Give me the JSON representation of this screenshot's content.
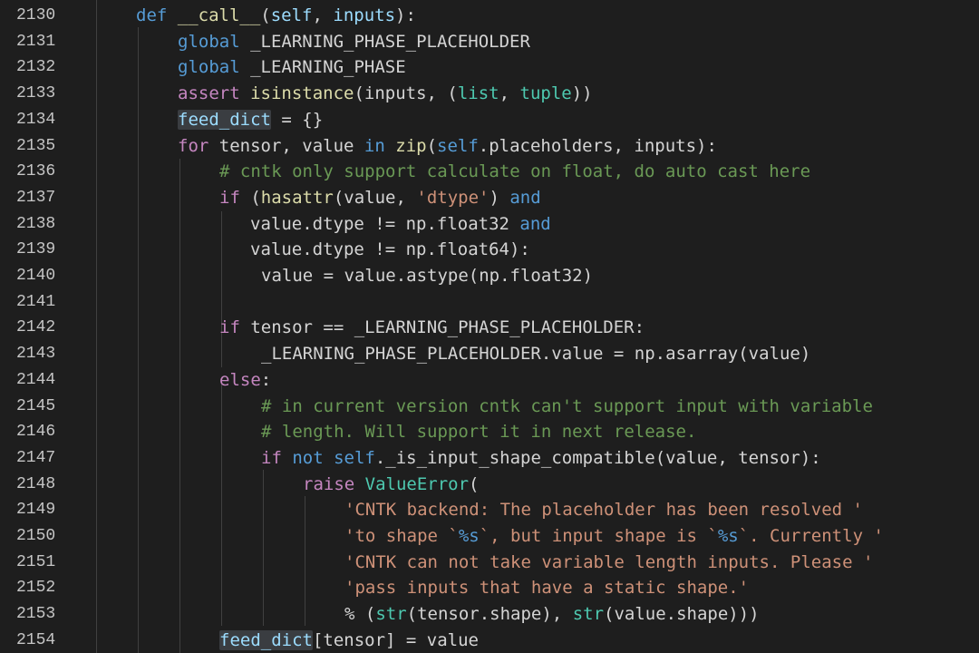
{
  "editor": {
    "language": "python",
    "colors": {
      "background": "#1e1e1e",
      "keyword": "#569cd6",
      "control": "#c586c0",
      "function": "#dcdcaa",
      "variable": "#9cdcfe",
      "string": "#ce9178",
      "class": "#4ec9b0",
      "comment": "#6a9955",
      "line_number": "#c5c5c5"
    },
    "lines": [
      {
        "n": "2130",
        "tokens": [
          [
            "kw",
            "def "
          ],
          [
            "fn",
            "__call__"
          ],
          [
            "plain",
            "("
          ],
          [
            "var",
            "self"
          ],
          [
            "plain",
            ", "
          ],
          [
            "var",
            "inputs"
          ],
          [
            "plain",
            "):"
          ]
        ]
      },
      {
        "n": "2131",
        "tokens": [
          [
            "kw",
            "global "
          ],
          [
            "plain",
            "_LEARNING_PHASE_PLACEHOLDER"
          ]
        ]
      },
      {
        "n": "2132",
        "tokens": [
          [
            "kw",
            "global "
          ],
          [
            "plain",
            "_LEARNING_PHASE"
          ]
        ]
      },
      {
        "n": "2133",
        "tokens": [
          [
            "ctl",
            "assert "
          ],
          [
            "fn",
            "isinstance"
          ],
          [
            "plain",
            "(inputs, ("
          ],
          [
            "cls",
            "list"
          ],
          [
            "plain",
            ", "
          ],
          [
            "cls",
            "tuple"
          ],
          [
            "plain",
            "))"
          ]
        ]
      },
      {
        "n": "2134",
        "tokens": [
          [
            "hl",
            "feed_dict"
          ],
          [
            "plain",
            " = {}"
          ]
        ]
      },
      {
        "n": "2135",
        "tokens": [
          [
            "ctl",
            "for "
          ],
          [
            "plain",
            "tensor, value "
          ],
          [
            "kw",
            "in "
          ],
          [
            "fn",
            "zip"
          ],
          [
            "plain",
            "("
          ],
          [
            "self",
            "self"
          ],
          [
            "plain",
            ".placeholders, inputs):"
          ]
        ]
      },
      {
        "n": "2136",
        "tokens": [
          [
            "com",
            "# cntk only support calculate on float, do auto cast here"
          ]
        ]
      },
      {
        "n": "2137",
        "tokens": [
          [
            "ctl",
            "if "
          ],
          [
            "plain",
            "("
          ],
          [
            "fn",
            "hasattr"
          ],
          [
            "plain",
            "(value, "
          ],
          [
            "str",
            "'dtype'"
          ],
          [
            "plain",
            ") "
          ],
          [
            "kw",
            "and"
          ]
        ]
      },
      {
        "n": "2138",
        "tokens": [
          [
            "plain",
            "value.dtype != np.float32 "
          ],
          [
            "kw",
            "and"
          ]
        ]
      },
      {
        "n": "2139",
        "tokens": [
          [
            "plain",
            "value.dtype != np.float64):"
          ]
        ]
      },
      {
        "n": "2140",
        "tokens": [
          [
            "plain",
            "value = value.astype(np.float32)"
          ]
        ]
      },
      {
        "n": "2141",
        "tokens": []
      },
      {
        "n": "2142",
        "tokens": [
          [
            "ctl",
            "if "
          ],
          [
            "plain",
            "tensor == _LEARNING_PHASE_PLACEHOLDER:"
          ]
        ]
      },
      {
        "n": "2143",
        "tokens": [
          [
            "plain",
            "_LEARNING_PHASE_PLACEHOLDER.value = np.asarray(value)"
          ]
        ]
      },
      {
        "n": "2144",
        "tokens": [
          [
            "ctl",
            "else"
          ],
          [
            "plain",
            ":"
          ]
        ]
      },
      {
        "n": "2145",
        "tokens": [
          [
            "com",
            "# in current version cntk can't support input with variable"
          ]
        ]
      },
      {
        "n": "2146",
        "tokens": [
          [
            "com",
            "# length. Will support it in next release."
          ]
        ]
      },
      {
        "n": "2147",
        "tokens": [
          [
            "ctl",
            "if "
          ],
          [
            "kw",
            "not "
          ],
          [
            "self",
            "self"
          ],
          [
            "plain",
            "._is_input_shape_compatible(value, tensor):"
          ]
        ]
      },
      {
        "n": "2148",
        "tokens": [
          [
            "ctl",
            "raise "
          ],
          [
            "cls",
            "ValueError"
          ],
          [
            "plain",
            "("
          ]
        ]
      },
      {
        "n": "2149",
        "tokens": [
          [
            "str",
            "'CNTK backend: The placeholder has been resolved '"
          ]
        ]
      },
      {
        "n": "2150",
        "tokens": [
          [
            "str",
            "'to shape `"
          ],
          [
            "esc",
            "%s"
          ],
          [
            "str",
            "`, but input shape is `"
          ],
          [
            "esc",
            "%s"
          ],
          [
            "str",
            "`. Currently '"
          ]
        ]
      },
      {
        "n": "2151",
        "tokens": [
          [
            "str",
            "'CNTK can not take variable length inputs. Please '"
          ]
        ]
      },
      {
        "n": "2152",
        "tokens": [
          [
            "str",
            "'pass inputs that have a static shape.'"
          ]
        ]
      },
      {
        "n": "2153",
        "tokens": [
          [
            "plain",
            "% ("
          ],
          [
            "cls",
            "str"
          ],
          [
            "plain",
            "(tensor.shape), "
          ],
          [
            "cls",
            "str"
          ],
          [
            "plain",
            "(value.shape)))"
          ]
        ]
      },
      {
        "n": "2154",
        "tokens": [
          [
            "hl",
            "feed_dict"
          ],
          [
            "plain",
            "[tensor] = value"
          ]
        ]
      }
    ]
  }
}
